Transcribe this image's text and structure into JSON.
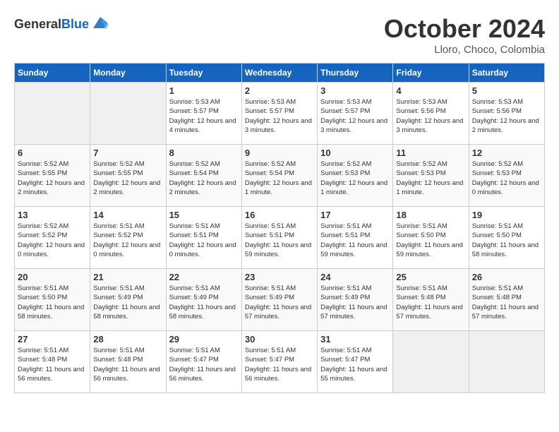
{
  "header": {
    "logo_general": "General",
    "logo_blue": "Blue",
    "month": "October 2024",
    "location": "Lloro, Choco, Colombia"
  },
  "days_of_week": [
    "Sunday",
    "Monday",
    "Tuesday",
    "Wednesday",
    "Thursday",
    "Friday",
    "Saturday"
  ],
  "weeks": [
    [
      {
        "day": "",
        "empty": true
      },
      {
        "day": "",
        "empty": true
      },
      {
        "day": "1",
        "sunrise": "5:53 AM",
        "sunset": "5:57 PM",
        "daylight": "12 hours and 4 minutes."
      },
      {
        "day": "2",
        "sunrise": "5:53 AM",
        "sunset": "5:57 PM",
        "daylight": "12 hours and 3 minutes."
      },
      {
        "day": "3",
        "sunrise": "5:53 AM",
        "sunset": "5:57 PM",
        "daylight": "12 hours and 3 minutes."
      },
      {
        "day": "4",
        "sunrise": "5:53 AM",
        "sunset": "5:56 PM",
        "daylight": "12 hours and 3 minutes."
      },
      {
        "day": "5",
        "sunrise": "5:53 AM",
        "sunset": "5:56 PM",
        "daylight": "12 hours and 2 minutes."
      }
    ],
    [
      {
        "day": "6",
        "sunrise": "5:52 AM",
        "sunset": "5:55 PM",
        "daylight": "12 hours and 2 minutes."
      },
      {
        "day": "7",
        "sunrise": "5:52 AM",
        "sunset": "5:55 PM",
        "daylight": "12 hours and 2 minutes."
      },
      {
        "day": "8",
        "sunrise": "5:52 AM",
        "sunset": "5:54 PM",
        "daylight": "12 hours and 2 minutes."
      },
      {
        "day": "9",
        "sunrise": "5:52 AM",
        "sunset": "5:54 PM",
        "daylight": "12 hours and 1 minute."
      },
      {
        "day": "10",
        "sunrise": "5:52 AM",
        "sunset": "5:53 PM",
        "daylight": "12 hours and 1 minute."
      },
      {
        "day": "11",
        "sunrise": "5:52 AM",
        "sunset": "5:53 PM",
        "daylight": "12 hours and 1 minute."
      },
      {
        "day": "12",
        "sunrise": "5:52 AM",
        "sunset": "5:53 PM",
        "daylight": "12 hours and 0 minutes."
      }
    ],
    [
      {
        "day": "13",
        "sunrise": "5:52 AM",
        "sunset": "5:52 PM",
        "daylight": "12 hours and 0 minutes."
      },
      {
        "day": "14",
        "sunrise": "5:51 AM",
        "sunset": "5:52 PM",
        "daylight": "12 hours and 0 minutes."
      },
      {
        "day": "15",
        "sunrise": "5:51 AM",
        "sunset": "5:51 PM",
        "daylight": "12 hours and 0 minutes."
      },
      {
        "day": "16",
        "sunrise": "5:51 AM",
        "sunset": "5:51 PM",
        "daylight": "11 hours and 59 minutes."
      },
      {
        "day": "17",
        "sunrise": "5:51 AM",
        "sunset": "5:51 PM",
        "daylight": "11 hours and 59 minutes."
      },
      {
        "day": "18",
        "sunrise": "5:51 AM",
        "sunset": "5:50 PM",
        "daylight": "11 hours and 59 minutes."
      },
      {
        "day": "19",
        "sunrise": "5:51 AM",
        "sunset": "5:50 PM",
        "daylight": "11 hours and 58 minutes."
      }
    ],
    [
      {
        "day": "20",
        "sunrise": "5:51 AM",
        "sunset": "5:50 PM",
        "daylight": "11 hours and 58 minutes."
      },
      {
        "day": "21",
        "sunrise": "5:51 AM",
        "sunset": "5:49 PM",
        "daylight": "11 hours and 58 minutes."
      },
      {
        "day": "22",
        "sunrise": "5:51 AM",
        "sunset": "5:49 PM",
        "daylight": "11 hours and 58 minutes."
      },
      {
        "day": "23",
        "sunrise": "5:51 AM",
        "sunset": "5:49 PM",
        "daylight": "11 hours and 57 minutes."
      },
      {
        "day": "24",
        "sunrise": "5:51 AM",
        "sunset": "5:49 PM",
        "daylight": "11 hours and 57 minutes."
      },
      {
        "day": "25",
        "sunrise": "5:51 AM",
        "sunset": "5:48 PM",
        "daylight": "11 hours and 57 minutes."
      },
      {
        "day": "26",
        "sunrise": "5:51 AM",
        "sunset": "5:48 PM",
        "daylight": "11 hours and 57 minutes."
      }
    ],
    [
      {
        "day": "27",
        "sunrise": "5:51 AM",
        "sunset": "5:48 PM",
        "daylight": "11 hours and 56 minutes."
      },
      {
        "day": "28",
        "sunrise": "5:51 AM",
        "sunset": "5:48 PM",
        "daylight": "11 hours and 56 minutes."
      },
      {
        "day": "29",
        "sunrise": "5:51 AM",
        "sunset": "5:47 PM",
        "daylight": "11 hours and 56 minutes."
      },
      {
        "day": "30",
        "sunrise": "5:51 AM",
        "sunset": "5:47 PM",
        "daylight": "11 hours and 56 minutes."
      },
      {
        "day": "31",
        "sunrise": "5:51 AM",
        "sunset": "5:47 PM",
        "daylight": "11 hours and 55 minutes."
      },
      {
        "day": "",
        "empty": true
      },
      {
        "day": "",
        "empty": true
      }
    ]
  ]
}
